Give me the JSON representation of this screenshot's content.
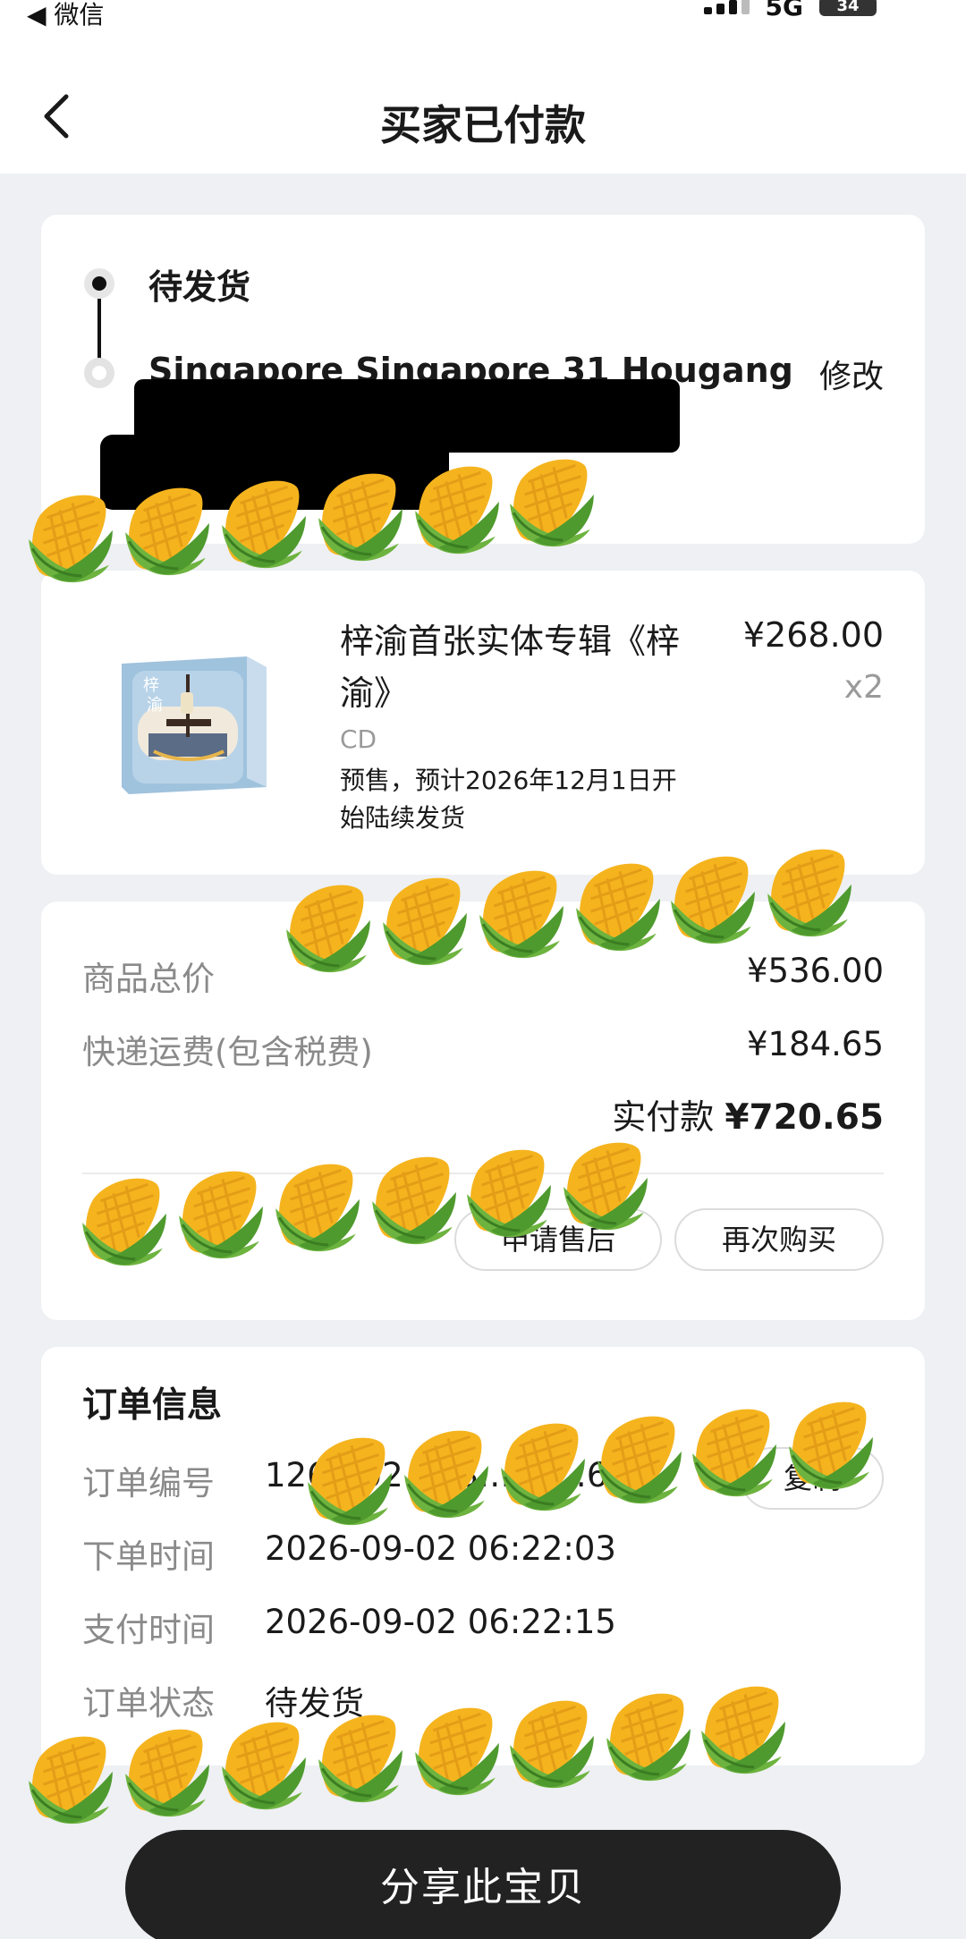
{
  "status_bar": {
    "back_label": "◀ 微信",
    "network": "5G",
    "battery": "34"
  },
  "header": {
    "title": "买家已付款"
  },
  "shipping": {
    "status": "待发货",
    "address": "Singapore Singapore 31 Hougang",
    "modify_label": "修改"
  },
  "product": {
    "name": "梓渝首张实体专辑《梓渝》",
    "price": "¥268.00",
    "qty": "x2",
    "spec": "CD",
    "note": "预售，预计2026年12月1日开始陆续发货"
  },
  "summary": {
    "goods_total_label": "商品总价",
    "goods_total": "¥536.00",
    "shipping_label": "快递运费(包含税费)",
    "shipping_fee": "¥184.65",
    "paid_label": "实付款",
    "paid_total": "¥720.65",
    "after_sale_label": "申请售后",
    "rebuy_label": "再次购买"
  },
  "order_info": {
    "title": "订单信息",
    "number_label": "订单编号",
    "number": "126…02…08…88…6",
    "copy_label": "复制",
    "created_label": "下单时间",
    "created": "2026-09-02 06:22:03",
    "paid_time_label": "支付时间",
    "paid_time": "2026-09-02 06:22:15",
    "status_label": "订单状态",
    "status": "待发货"
  },
  "share": {
    "label": "分享此宝贝"
  },
  "colors": {
    "background": "#eef0f3",
    "card": "#ffffff",
    "primary_text": "#1a1a1a",
    "secondary_text": "#8a8a8a",
    "share_button": "#222222",
    "sticker": "#f5b41e"
  },
  "icons": {
    "back": "chevron-left-icon",
    "sticker": "corn-icon",
    "timeline": "timeline-dot-icon"
  }
}
